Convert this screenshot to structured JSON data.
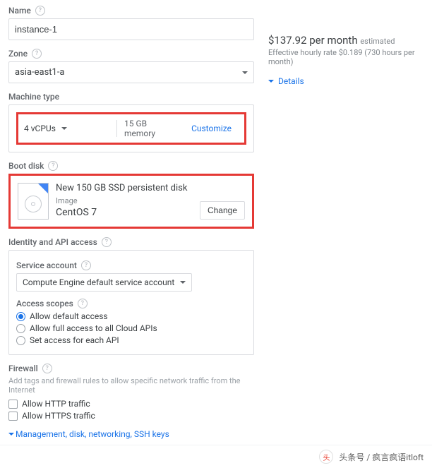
{
  "name": {
    "label": "Name",
    "value": "instance-1"
  },
  "zone": {
    "label": "Zone",
    "value": "asia-east1-a"
  },
  "machine": {
    "label": "Machine type",
    "vcpu": "4 vCPUs",
    "memory": "15 GB memory",
    "customize": "Customize"
  },
  "boot": {
    "label": "Boot disk",
    "title": "New 150 GB SSD persistent disk",
    "sub": "Image",
    "image": "CentOS 7",
    "change": "Change"
  },
  "identity": {
    "label": "Identity and API access",
    "service_label": "Service account",
    "service_value": "Compute Engine default service account",
    "scopes_label": "Access scopes",
    "scopes": [
      "Allow default access",
      "Allow full access to all Cloud APIs",
      "Set access for each API"
    ],
    "selected": 0
  },
  "firewall": {
    "label": "Firewall",
    "note": "Add tags and firewall rules to allow specific network traffic from the Internet",
    "http": "Allow HTTP traffic",
    "https": "Allow HTTPS traffic"
  },
  "expand": "Management, disk, networking, SSH keys",
  "pricing": {
    "price": "$137.92 per month",
    "est": "estimated",
    "rate": "Effective hourly rate $0.189 (730 hours per month)",
    "details": "Details"
  },
  "footer": {
    "credit": "头条号 / 疯言疯语itloft"
  }
}
